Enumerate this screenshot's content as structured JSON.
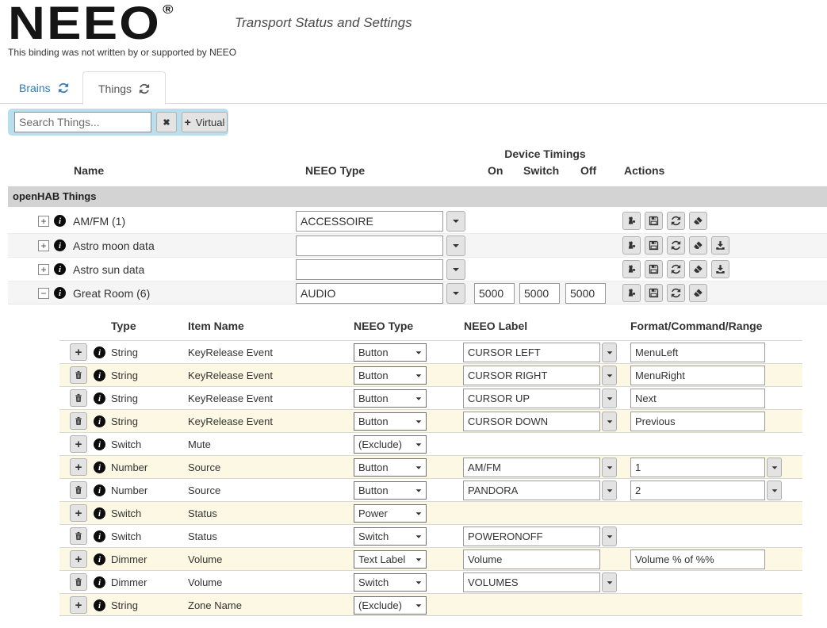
{
  "header": {
    "logo": "NEEO",
    "registered": "®",
    "title": "Transport Status and Settings",
    "disclaimer": "This binding was not written by or supported by NEEO"
  },
  "tabs": {
    "brains": "Brains",
    "things": "Things"
  },
  "toolbar": {
    "search_placeholder": "Search Things...",
    "clear_glyph": "✖",
    "plus_glyph": "+",
    "virtual_label": "Virtual"
  },
  "things_table": {
    "group_header": "openHAB Things",
    "device_timings_header": "Device Timings",
    "columns": {
      "name": "Name",
      "neeo_type": "NEEO Type",
      "on": "On",
      "switch": "Switch",
      "off": "Off",
      "actions": "Actions"
    },
    "rows": [
      {
        "name": "AM/FM (1)",
        "neeo_type": "ACCESSOIRE"
      },
      {
        "name": "Astro moon data",
        "neeo_type": ""
      },
      {
        "name": "Astro sun data",
        "neeo_type": ""
      },
      {
        "name": "Great Room (6)",
        "neeo_type": "AUDIO",
        "timing_on": "5000",
        "timing_switch": "5000",
        "timing_off": "5000"
      }
    ]
  },
  "channels_table": {
    "columns": {
      "type": "Type",
      "item_name": "Item Name",
      "neeo_type": "NEEO Type",
      "neeo_label": "NEEO Label",
      "format": "Format/Command/Range"
    },
    "rows": [
      {
        "type": "String",
        "item_name": "KeyRelease Event",
        "neeo_type": "Button",
        "neeo_label": "CURSOR LEFT",
        "format": "MenuLeft"
      },
      {
        "type": "String",
        "item_name": "KeyRelease Event",
        "neeo_type": "Button",
        "neeo_label": "CURSOR RIGHT",
        "format": "MenuRight"
      },
      {
        "type": "String",
        "item_name": "KeyRelease Event",
        "neeo_type": "Button",
        "neeo_label": "CURSOR UP",
        "format": "Next"
      },
      {
        "type": "String",
        "item_name": "KeyRelease Event",
        "neeo_type": "Button",
        "neeo_label": "CURSOR DOWN",
        "format": "Previous"
      },
      {
        "type": "Switch",
        "item_name": "Mute",
        "neeo_type": "(Exclude)"
      },
      {
        "type": "Number",
        "item_name": "Source",
        "neeo_type": "Button",
        "neeo_label": "AM/FM",
        "format": "1"
      },
      {
        "type": "Number",
        "item_name": "Source",
        "neeo_type": "Button",
        "neeo_label": "PANDORA",
        "format": "2"
      },
      {
        "type": "Switch",
        "item_name": "Status",
        "neeo_type": "Power"
      },
      {
        "type": "Switch",
        "item_name": "Status",
        "neeo_type": "Switch",
        "neeo_label": "POWERONOFF"
      },
      {
        "type": "Dimmer",
        "item_name": "Volume",
        "neeo_type": "Text Label",
        "neeo_label": "Volume",
        "format": "Volume % of %%"
      },
      {
        "type": "Dimmer",
        "item_name": "Volume",
        "neeo_type": "Switch",
        "neeo_label": "VOLUMES"
      },
      {
        "type": "String",
        "item_name": "Zone Name",
        "neeo_type": "(Exclude)"
      }
    ]
  },
  "icons": {
    "expand": "+",
    "collapse": "−",
    "add": "+",
    "info": "i",
    "refresh": "two-arc-arrows",
    "save": "floppy-disk",
    "eraser": "slanted-eraser",
    "download": "arrow-into-tray",
    "pawn": "pawn-with-peg",
    "trash": "trash-can"
  }
}
